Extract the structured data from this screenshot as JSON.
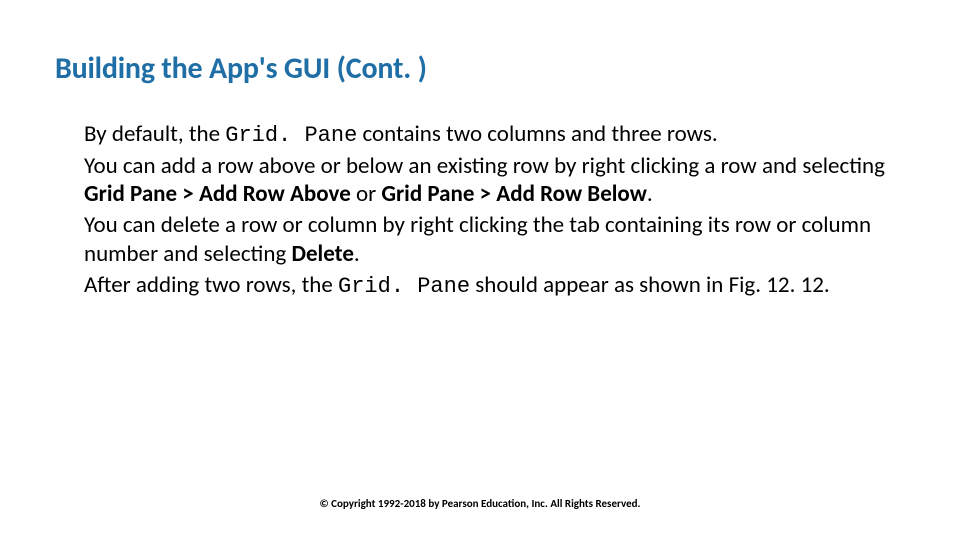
{
  "title": "Building the App's GUI (Cont. )",
  "bullets": {
    "b1a": "By default, the ",
    "b1_code": "Grid. Pane",
    "b1b": " contains two columns and three rows.",
    "b2a": "You can add a row above or below an existing row by right clicking a row and selecting ",
    "b2_bold1": "Grid Pane > Add Row Above",
    "b2b": " or ",
    "b2_bold2": "Grid Pane > Add Row Below",
    "b2c": ".",
    "b3a": "You can delete a row or column by right clicking the tab containing its row or column number and selecting ",
    "b3_bold": "Delete",
    "b3b": ".",
    "b4a": "After adding two rows, the ",
    "b4_code": "Grid. Pane",
    "b4b": " should appear as shown in Fig. 12. 12."
  },
  "bullet_glyph": "",
  "footer": "© Copyright 1992-2018 by Pearson Education, Inc. All Rights Reserved."
}
